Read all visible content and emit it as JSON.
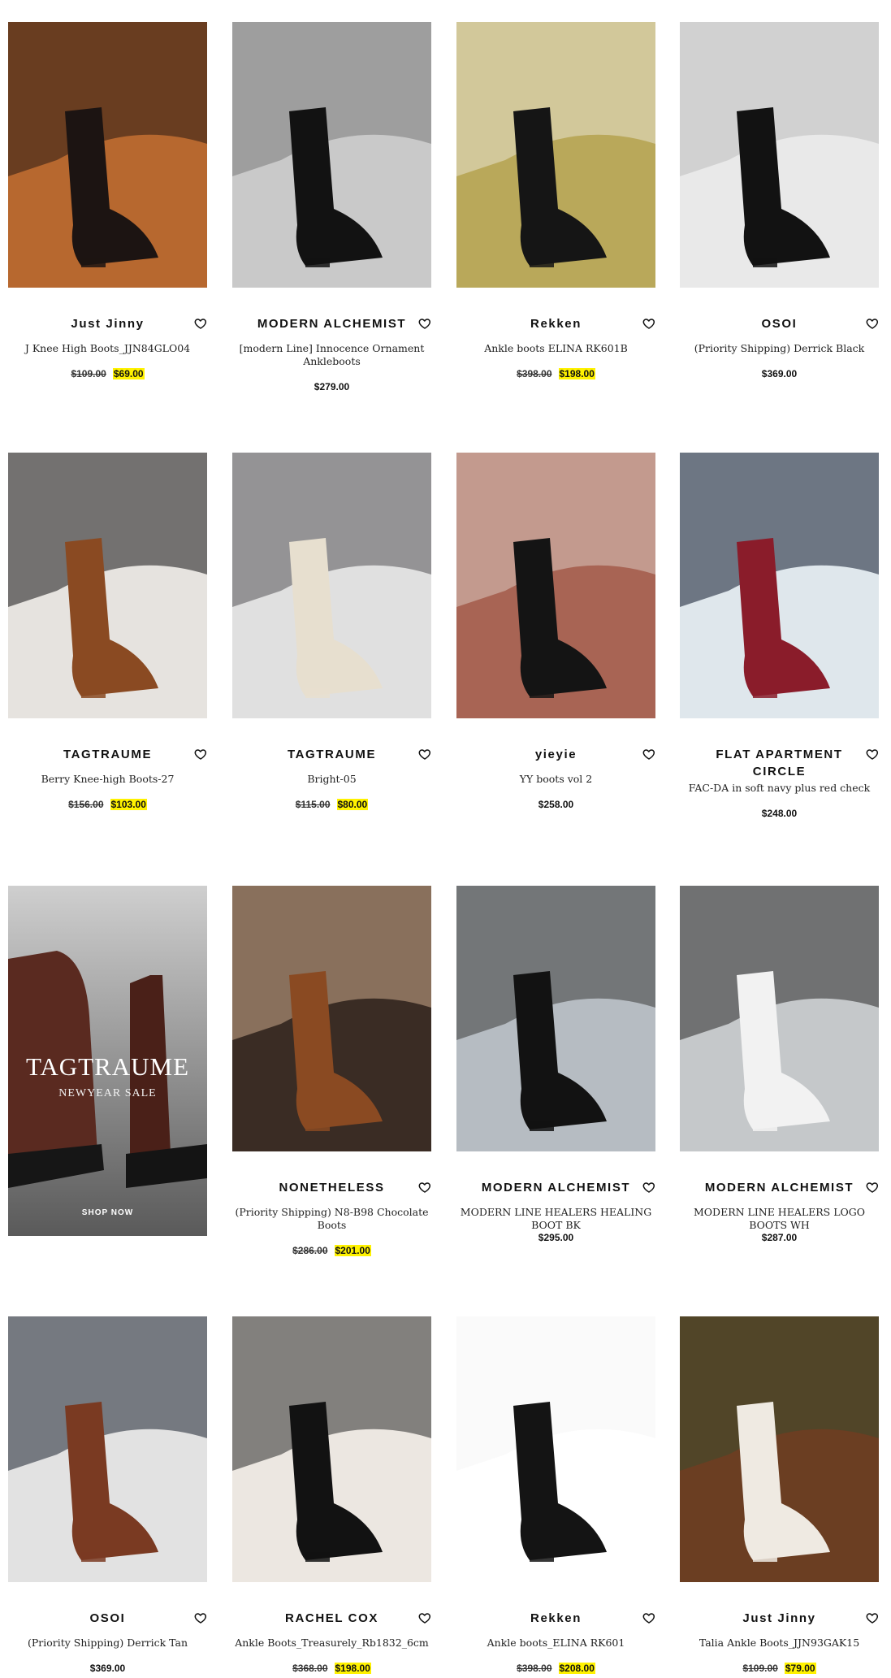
{
  "products": [
    {
      "brand": "Just Jinny",
      "name": "J Knee High Boots_JJN84GLO04",
      "old_price": "$109.00",
      "price": "$69.00"
    },
    {
      "brand": "MODERN ALCHEMIST",
      "name": "[modern Line] Innocence Ornament Ankleboots",
      "old_price": "",
      "price": "$279.00"
    },
    {
      "brand": "Rekken",
      "name": "Ankle boots ELINA RK601B",
      "old_price": "$398.00",
      "price": "$198.00"
    },
    {
      "brand": "OSOI",
      "name": "(Priority Shipping) Derrick Black",
      "old_price": "",
      "price": "$369.00"
    },
    {
      "brand": "TAGTRAUME",
      "name": "Berry Knee-high Boots-27",
      "old_price": "$156.00",
      "price": "$103.00"
    },
    {
      "brand": "TAGTRAUME",
      "name": "Bright-05",
      "old_price": "$115.00",
      "price": "$80.00"
    },
    {
      "brand": "yieyie",
      "name": "YY boots vol 2",
      "old_price": "",
      "price": "$258.00"
    },
    {
      "brand": "FLAT APARTMENT CIRCLE",
      "name": "FAC-DA in soft navy plus red check",
      "old_price": "",
      "price": "$248.00"
    },
    {
      "brand": "NONETHELESS",
      "name": "(Priority Shipping) N8-B98 Chocolate Boots",
      "old_price": "$286.00",
      "price": "$201.00"
    },
    {
      "brand": "MODERN ALCHEMIST",
      "name": "MODERN LINE HEALERS HEALING BOOT BK",
      "old_price": "",
      "price": "$295.00"
    },
    {
      "brand": "MODERN ALCHEMIST",
      "name": "MODERN LINE HEALERS LOGO BOOTS WH",
      "old_price": "",
      "price": "$287.00"
    },
    {
      "brand": "OSOI",
      "name": "(Priority Shipping) Derrick Tan",
      "old_price": "",
      "price": "$369.00"
    },
    {
      "brand": "RACHEL COX",
      "name": "Ankle Boots_Treasurely_Rb1832_6cm",
      "old_price": "$368.00",
      "price": "$198.00"
    },
    {
      "brand": "Rekken",
      "name": "Ankle boots_ELINA RK601",
      "old_price": "$398.00",
      "price": "$208.00"
    },
    {
      "brand": "Just Jinny",
      "name": "Talia Ankle Boots_JJN93GAK15",
      "old_price": "$109.00",
      "price": "$79.00"
    }
  ],
  "promo": {
    "title": "TAGTRAUME",
    "subtitle": "NEWYEAR SALE",
    "button": "SHOP NOW"
  },
  "colors": {
    "sale_highlight": "#fff200",
    "text": "#111111"
  },
  "icons": {
    "wishlist": "heart-outline-icon"
  }
}
